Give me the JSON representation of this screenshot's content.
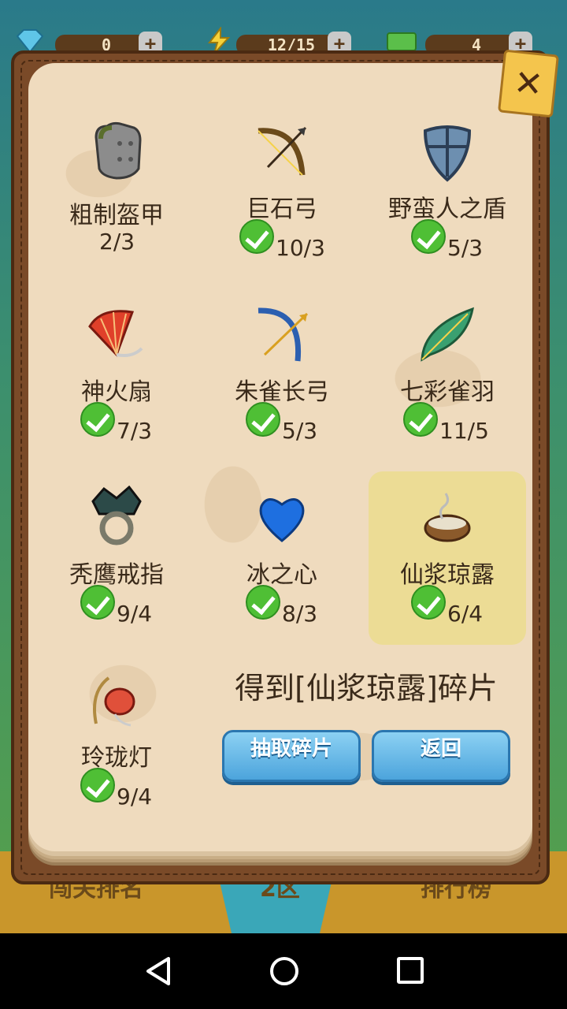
{
  "status": {
    "gems": "0",
    "energy": "12/15",
    "cash": "4",
    "plus": "+"
  },
  "background_bottom": {
    "left_label": "闯关排名",
    "center_label": "2区",
    "right_label": "排行榜"
  },
  "close_label": "✕",
  "items": [
    {
      "name": "粗制盔甲",
      "count": "2/3",
      "checked": false,
      "icon": "armor-icon"
    },
    {
      "name": "巨石弓",
      "count": "10/3",
      "checked": true,
      "icon": "bow-icon"
    },
    {
      "name": "野蛮人之盾",
      "count": "5/3",
      "checked": true,
      "icon": "shield-icon"
    },
    {
      "name": "神火扇",
      "count": "7/3",
      "checked": true,
      "icon": "fan-icon"
    },
    {
      "name": "朱雀长弓",
      "count": "5/3",
      "checked": true,
      "icon": "longbow-icon"
    },
    {
      "name": "七彩雀羽",
      "count": "11/5",
      "checked": true,
      "icon": "feather-icon"
    },
    {
      "name": "秃鹰戒指",
      "count": "9/4",
      "checked": true,
      "icon": "ring-icon"
    },
    {
      "name": "冰之心",
      "count": "8/3",
      "checked": true,
      "icon": "ice-heart-icon"
    },
    {
      "name": "仙浆琼露",
      "count": "6/4",
      "checked": true,
      "icon": "bowl-icon",
      "selected": true
    },
    {
      "name": "玲珑灯",
      "count": "9/4",
      "checked": true,
      "icon": "lantern-icon"
    }
  ],
  "message": "得到[仙浆琼露]碎片",
  "buttons": {
    "draw": "抽取碎片",
    "back": "返回"
  }
}
